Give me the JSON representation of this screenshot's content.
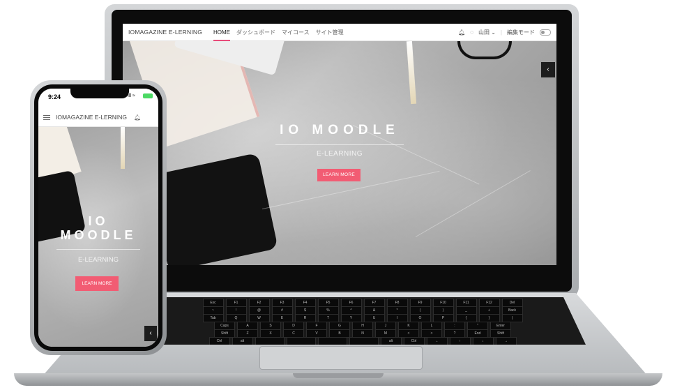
{
  "laptop": {
    "nav": {
      "brand": "IOMAGAZINE E-LERNING",
      "links": [
        "HOME",
        "ダッシュボード",
        "マイコース",
        "サイト管理"
      ],
      "user": "山田 ⌄",
      "edit_mode_label": "編集モード"
    },
    "hero": {
      "title": "IO MOODLE",
      "subtitle": "E-LEARNING",
      "button": "LEARN MORE",
      "chevron": "‹"
    }
  },
  "phone": {
    "status": {
      "time": "9:24",
      "signal": "ıll ≈"
    },
    "nav": {
      "brand": "IOMAGAZINE E-LERNING"
    },
    "hero": {
      "title_line1": "IO",
      "title_line2": "MOODLE",
      "subtitle": "E-LEARNING",
      "button": "LEARN MORE",
      "chevron": "‹"
    }
  },
  "keyboard": {
    "rows": [
      [
        "Esc",
        "F1",
        "F2",
        "F3",
        "F4",
        "F5",
        "F6",
        "F7",
        "F8",
        "F9",
        "F10",
        "F11",
        "F12",
        "Del"
      ],
      [
        "~",
        "!",
        "@",
        "#",
        "$",
        "%",
        "^",
        "&",
        "*",
        "(",
        ")",
        "_",
        "+",
        "Back"
      ],
      [
        "Tab",
        "Q",
        "W",
        "E",
        "R",
        "T",
        "Y",
        "U",
        "I",
        "O",
        "P",
        "{",
        "}",
        "|"
      ],
      [
        "Caps",
        "A",
        "S",
        "D",
        "F",
        "G",
        "H",
        "J",
        "K",
        "L",
        ":",
        "\"",
        "Enter"
      ],
      [
        "Shift",
        "Z",
        "X",
        "C",
        "V",
        "B",
        "N",
        "M",
        "<",
        ">",
        "?",
        "End",
        "Shift"
      ],
      [
        "Ctrl",
        "alt",
        "",
        "",
        "",
        "",
        "alt",
        "Ctrl",
        "←",
        "↑",
        "↓",
        "→"
      ]
    ]
  },
  "colors": {
    "accent": "#f25c73",
    "nav_active": "#e94b7a"
  }
}
